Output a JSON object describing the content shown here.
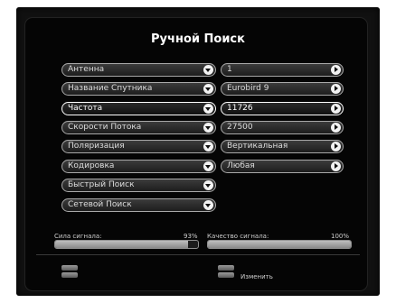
{
  "title": "Ручной Поиск",
  "left_items": [
    {
      "label": "Антенна",
      "selected": false
    },
    {
      "label": "Название Спутника",
      "selected": false
    },
    {
      "label": "Частота",
      "selected": true
    },
    {
      "label": "Скорости Потока",
      "selected": false
    },
    {
      "label": "Поляризация",
      "selected": false
    },
    {
      "label": "Кодировка",
      "selected": false
    },
    {
      "label": "Быстрый Поиск",
      "selected": false
    },
    {
      "label": "Сетевой Поиск",
      "selected": false
    }
  ],
  "right_values": [
    {
      "value": "1",
      "selected": false
    },
    {
      "value": "Eurobird 9",
      "selected": false
    },
    {
      "value": "11726",
      "selected": true
    },
    {
      "value": "27500",
      "selected": false
    },
    {
      "value": "Вертикальная",
      "selected": false
    },
    {
      "value": "Любая",
      "selected": false
    }
  ],
  "signal": {
    "strength_label": "Сила сигнала:",
    "strength_value": "93%",
    "strength_fraction": 0.93,
    "quality_label": "Качество сигнала:",
    "quality_value": "100%",
    "quality_fraction": 1.0
  },
  "footer": {
    "edit_label": "Изменить"
  }
}
